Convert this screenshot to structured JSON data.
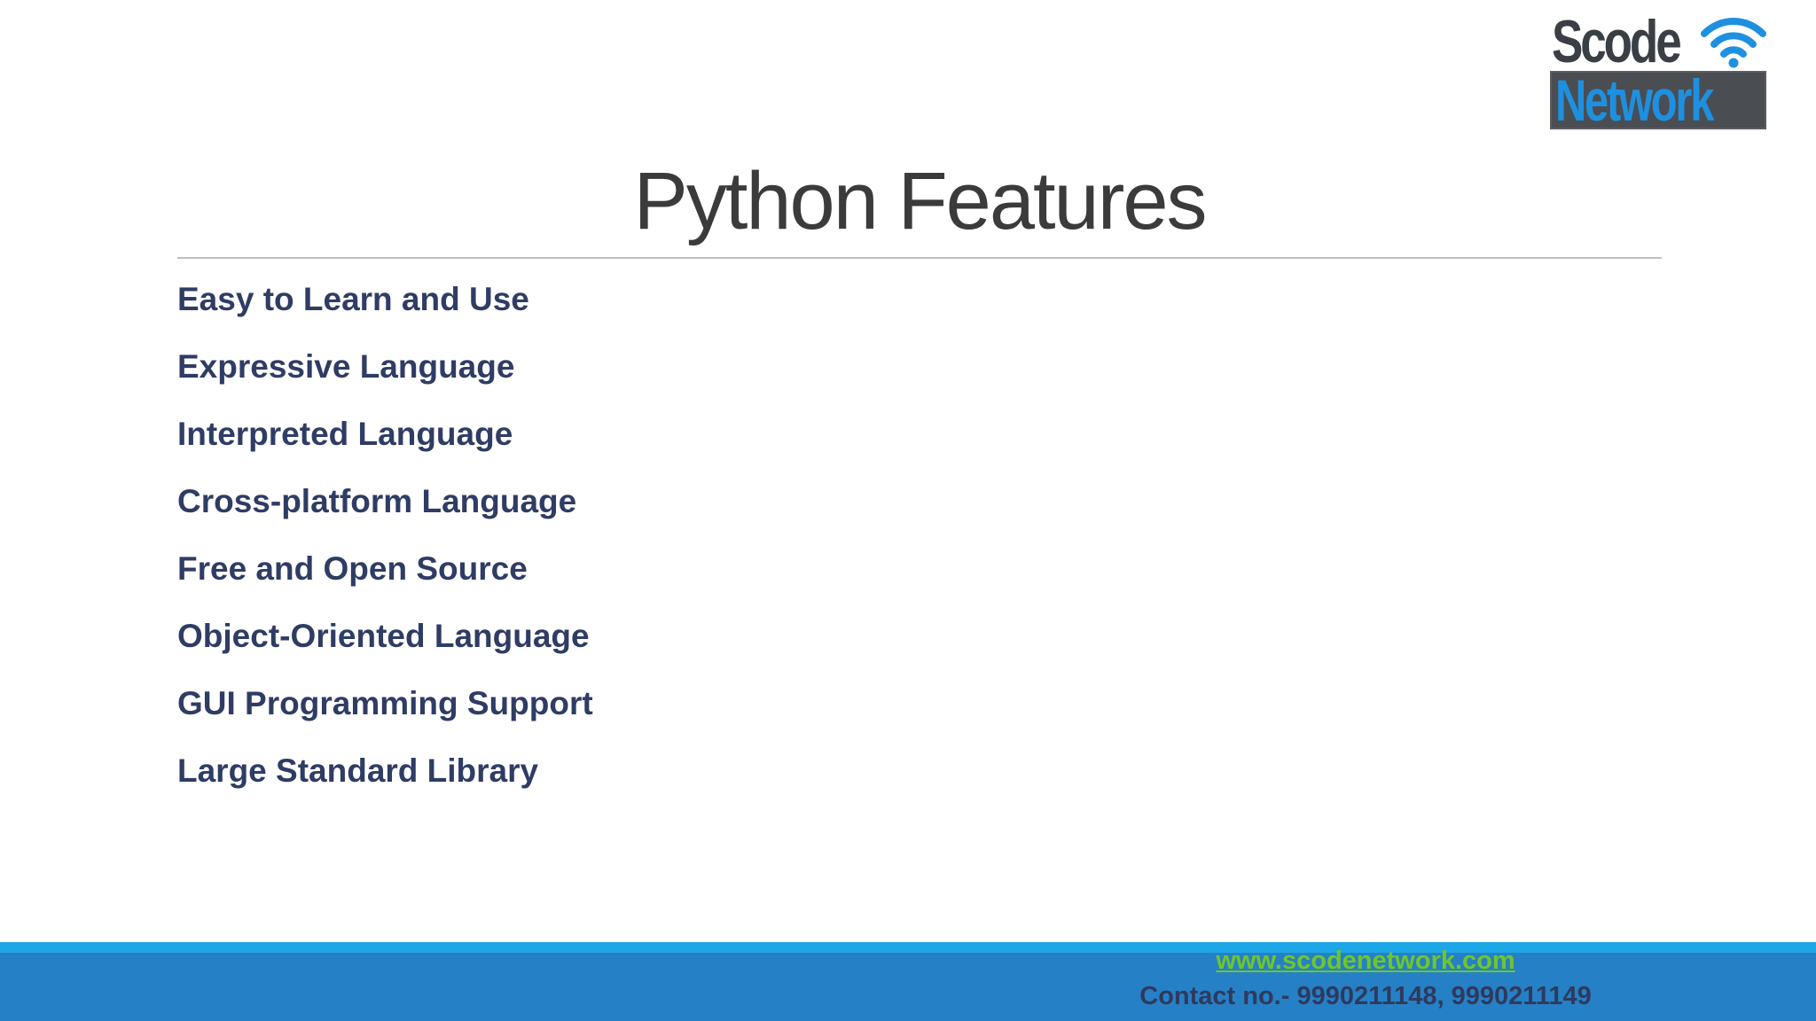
{
  "logo": {
    "top_text": "Scode",
    "bottom_text": "Network",
    "icon": "wifi-icon",
    "colors": {
      "top_text": "#3a3f45",
      "bottom_text": "#1e90e0",
      "bottom_bg": "#4a4d52",
      "wifi": "#1e90e0"
    }
  },
  "slide": {
    "title": "Python Features",
    "features": [
      "Easy to Learn and Use",
      "Expressive Language",
      "Interpreted Language",
      "Cross-platform Language",
      "Free and Open Source",
      "Object-Oriented Language",
      "GUI Programming Support",
      "Large Standard Library"
    ]
  },
  "footer": {
    "website": "www.scodenetwork.com",
    "contact": "Contact no.- 9990211148, 9990211149",
    "colors": {
      "stripe": "#1ea7e6",
      "bar": "#2680c5",
      "link": "#6fc62b",
      "contact": "#2e3a5e"
    }
  },
  "colors": {
    "title": "#3b3b3b",
    "bullet_text": "#2f3c64",
    "rule": "#bfbfbf"
  }
}
